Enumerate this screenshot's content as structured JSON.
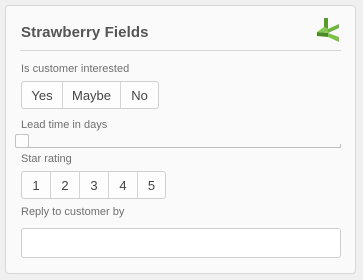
{
  "card": {
    "title": "Strawberry Fields",
    "logo_icon": "green-leaf-logo-icon",
    "accent_color": "#5a9a2d"
  },
  "fields": {
    "interest": {
      "label": "Is customer interested",
      "options": [
        "Yes",
        "Maybe",
        "No"
      ]
    },
    "lead_time": {
      "label": "Lead time in days",
      "slider_value_fraction": 0
    },
    "star_rating": {
      "label": "Star rating",
      "options": [
        "1",
        "2",
        "3",
        "4",
        "5"
      ]
    },
    "reply_by": {
      "label": "Reply to customer by",
      "value": "",
      "placeholder": ""
    }
  }
}
